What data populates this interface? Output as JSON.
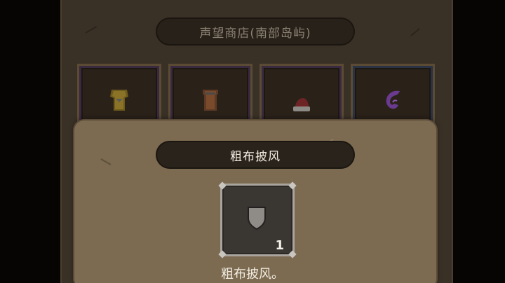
{
  "shop": {
    "title": "声望商店(南部岛屿)",
    "slots": [
      {
        "icon": "yellow-armor-icon",
        "frame": "purple"
      },
      {
        "icon": "leather-armor-icon",
        "frame": "purple"
      },
      {
        "icon": "red-hat-icon",
        "frame": "purple"
      },
      {
        "icon": "purple-swirl-icon",
        "frame": "blue"
      }
    ]
  },
  "popup": {
    "item_name": "粗布披风",
    "item_icon": "cloak-shield-icon",
    "quantity": "1",
    "description": "粗布披风。"
  },
  "colors": {
    "background": "#060504",
    "shop_panel": "#3a3126",
    "popup_panel": "#7c6a51",
    "pill": "#2a231b",
    "item_frame": "#a9a59e"
  }
}
